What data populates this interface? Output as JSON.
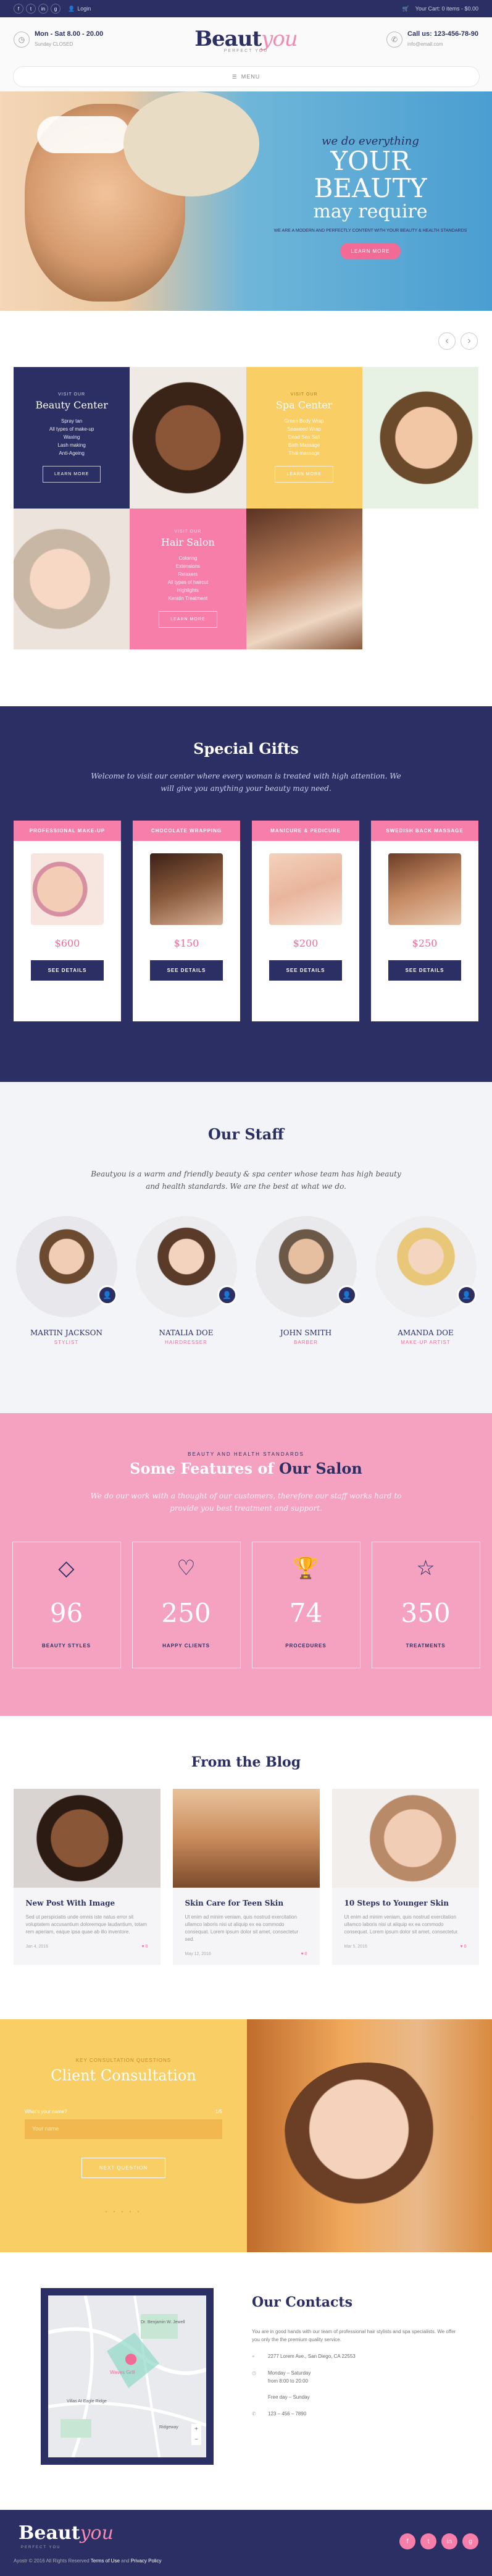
{
  "topbar": {
    "social": [
      "f",
      "t",
      "in",
      "g"
    ],
    "login": "Login",
    "cart": "Your Cart: 0 items - $0.00"
  },
  "header": {
    "hours": "Mon - Sat 8.00 - 20.00",
    "hours_sub": "Sunday CLOSED",
    "logo_main": "Beaut",
    "logo_accent": "you",
    "logo_sub": "PERFECT YOU",
    "call": "Call us: 123-456-78-90",
    "email": "info@email.com",
    "menu": "MENU"
  },
  "hero": {
    "kicker": "we do everything",
    "title": "YOUR BEAUTY",
    "title2": "may require",
    "desc": "WE ARE A MODERN AND PERFECTLY CONTENT WITH YOUR BEAUTY & HEALTH STANDARDS",
    "button": "LEARN MORE"
  },
  "services": [
    {
      "kicker": "VISIT OUR",
      "title": "Beauty Center",
      "items": [
        "Spray tan",
        "All types of make-up",
        "Waxing",
        "Lash making",
        "Anti-Ageing"
      ],
      "button": "LEARN MORE"
    },
    {
      "kicker": "VISIT OUR",
      "title": "Spa Center",
      "items": [
        "Green Body Wrap",
        "Seaweed Wrap",
        "Dead Sea Salt",
        "Bath Massage",
        "Thai massage"
      ],
      "button": "LEARN MORE"
    },
    {
      "kicker": "VISIT OUR",
      "title": "Hair Salon",
      "items": [
        "Coloring",
        "Extensions",
        "Relaxers",
        "All types of haircut",
        "Highlights",
        "Keratin Treatment"
      ],
      "button": "LEARN MORE"
    }
  ],
  "gifts": {
    "title": "Special Gifts",
    "subtitle": "Welcome to visit our center where every woman is treated with high attention. We will give you anything your beauty may need.",
    "cards": [
      {
        "label": "PROFESSIONAL MAKE-UP",
        "price": "$600",
        "button": "SEE DETAILS"
      },
      {
        "label": "CHOCOLATE WRAPPING",
        "price": "$150",
        "button": "SEE DETAILS"
      },
      {
        "label": "MANICURE & PEDICURE",
        "price": "$200",
        "button": "SEE DETAILS"
      },
      {
        "label": "SWEDISH BACK MASSAGE",
        "price": "$250",
        "button": "SEE DETAILS"
      }
    ]
  },
  "staff": {
    "title": "Our Staff",
    "subtitle": "Beautyou is a warm and friendly beauty & spa center whose team has high beauty and health standards. We are the best at what we do.",
    "members": [
      {
        "name": "MARTIN JACKSON",
        "role": "STYLIST"
      },
      {
        "name": "NATALIA DOE",
        "role": "HAIRDRESSER"
      },
      {
        "name": "JOHN SMITH",
        "role": "BARBER"
      },
      {
        "name": "AMANDA DOE",
        "role": "MAKE-UP ARTIST"
      }
    ]
  },
  "features": {
    "kicker": "BEAUTY AND HEALTH STANDARDS",
    "title_a": "Some Features of ",
    "title_b": "Our Salon",
    "subtitle": "We do our work with a thought of our customers, therefore our staff works hard to provide you best treatment and support.",
    "stats": [
      {
        "icon": "diamond-icon",
        "glyph": "◇",
        "value": "96",
        "label": "BEAUTY STYLES"
      },
      {
        "icon": "heart-icon",
        "glyph": "♡",
        "value": "250",
        "label": "HAPPY CLIENTS"
      },
      {
        "icon": "trophy-icon",
        "glyph": "🏆",
        "value": "74",
        "label": "PROCEDURES"
      },
      {
        "icon": "star-icon",
        "glyph": "☆",
        "value": "350",
        "label": "TREATMENTS"
      }
    ]
  },
  "blog": {
    "title": "From the Blog",
    "posts": [
      {
        "title": "New Post With Image",
        "excerpt": "Sed ut perspiciatis unde omnis iste natus error sit voluptatem accusantium doloremque laudantium, totam rem aperiam, eaque ipsa quae ab illo inventore.",
        "date": "Jan 4, 2016",
        "likes": "♥ 0"
      },
      {
        "title": "Skin Care for Teen Skin",
        "excerpt": "Ut enim ad minim veniam, quis nostrud exercitation ullamco laboris nisi ut aliquip ex ea commodo consequat. Lorem ipsum dolor sit amet, consectetur sed.",
        "date": "May 12, 2016",
        "likes": "♥ 0"
      },
      {
        "title": "10 Steps to Younger Skin",
        "excerpt": "Ut enim ad minim veniam, quis nostrud exercitation ullamco laboris nisi ut aliquip ex ea commodo consequat. Lorem ipsum dolor sit amet, consectetur.",
        "date": "Mar 5, 2016",
        "likes": "♥ 0"
      }
    ]
  },
  "consult": {
    "kicker": "KEY CONSULTATION QUESTIONS",
    "title": "Client Consultation",
    "question": "What's your name?",
    "step": "1/5",
    "placeholder": "Your name",
    "button": "NEXT QUESTION",
    "dots": "• • • • •"
  },
  "contacts": {
    "title": "Our Contacts",
    "intro": "You are in good hands with our team of professional hair stylists and spa specialists. We offer you only the the premium quality service.",
    "address": "2277 Lorem Ave., San Diego, CA 22553",
    "hours1": "Monday – Saturday",
    "hours2": "from 8:00 to 20:00",
    "hours3": "Free day – Sunday",
    "phone": "123 – 456 – 7890",
    "map_labels": [
      "Waves Grill",
      "Dr. Benjamin W. Jewell",
      "Villas At Eagle Ridge",
      "Ridgeway"
    ]
  },
  "footer": {
    "logo_main": "Beaut",
    "logo_accent": "you",
    "sub": "PERFECT YOU",
    "copy_a": "Ayostr © 2016 All Rights Reserved ",
    "terms": "Terms of Use",
    "and": " and ",
    "privacy": "Privacy Policy",
    "social": [
      "f",
      "t",
      "in",
      "g"
    ]
  },
  "colors": {
    "navy": "#2b2f63",
    "pink": "#f77ea9",
    "yellow": "#f8ce65"
  }
}
